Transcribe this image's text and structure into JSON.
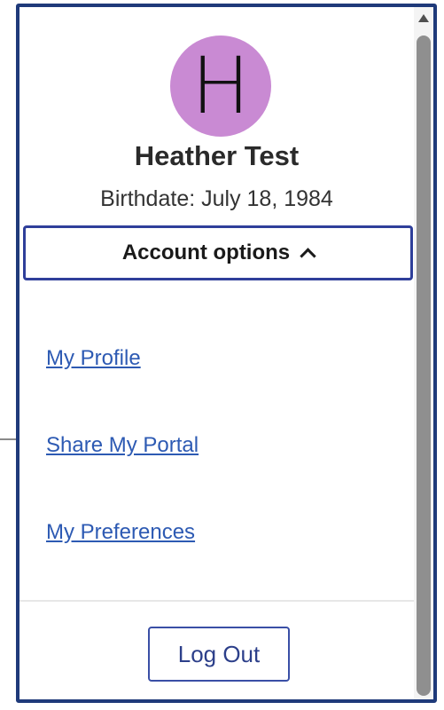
{
  "profile": {
    "avatar_initial": "H",
    "name": "Heather Test",
    "birthdate": "Birthdate: July 18, 1984"
  },
  "account_options": {
    "label": "Account options"
  },
  "menu": {
    "items": [
      {
        "label": "My Profile"
      },
      {
        "label": "Share My Portal"
      },
      {
        "label": "My Preferences"
      }
    ]
  },
  "actions": {
    "logout_label": "Log Out"
  },
  "colors": {
    "avatar_bg": "#c98ad3",
    "panel_border": "#1f3a7a",
    "link": "#2d5ab3"
  },
  "icons": {
    "account_toggle": "chevron-up-icon",
    "scroll_up": "scroll-up-arrow-icon"
  }
}
